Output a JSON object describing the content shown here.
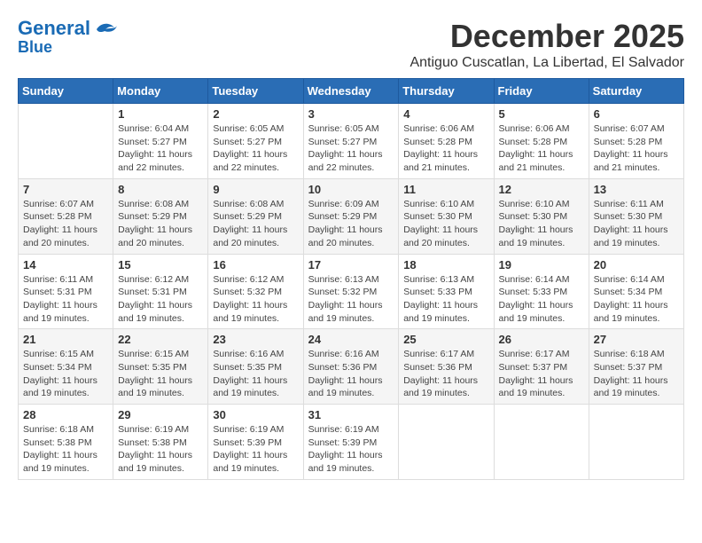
{
  "logo": {
    "line1": "General",
    "line2": "Blue"
  },
  "header": {
    "month": "December 2025",
    "location": "Antiguo Cuscatlan, La Libertad, El Salvador"
  },
  "weekdays": [
    "Sunday",
    "Monday",
    "Tuesday",
    "Wednesday",
    "Thursday",
    "Friday",
    "Saturday"
  ],
  "weeks": [
    [
      {
        "day": "",
        "info": ""
      },
      {
        "day": "1",
        "info": "Sunrise: 6:04 AM\nSunset: 5:27 PM\nDaylight: 11 hours\nand 22 minutes."
      },
      {
        "day": "2",
        "info": "Sunrise: 6:05 AM\nSunset: 5:27 PM\nDaylight: 11 hours\nand 22 minutes."
      },
      {
        "day": "3",
        "info": "Sunrise: 6:05 AM\nSunset: 5:27 PM\nDaylight: 11 hours\nand 22 minutes."
      },
      {
        "day": "4",
        "info": "Sunrise: 6:06 AM\nSunset: 5:28 PM\nDaylight: 11 hours\nand 21 minutes."
      },
      {
        "day": "5",
        "info": "Sunrise: 6:06 AM\nSunset: 5:28 PM\nDaylight: 11 hours\nand 21 minutes."
      },
      {
        "day": "6",
        "info": "Sunrise: 6:07 AM\nSunset: 5:28 PM\nDaylight: 11 hours\nand 21 minutes."
      }
    ],
    [
      {
        "day": "7",
        "info": "Sunrise: 6:07 AM\nSunset: 5:28 PM\nDaylight: 11 hours\nand 20 minutes."
      },
      {
        "day": "8",
        "info": "Sunrise: 6:08 AM\nSunset: 5:29 PM\nDaylight: 11 hours\nand 20 minutes."
      },
      {
        "day": "9",
        "info": "Sunrise: 6:08 AM\nSunset: 5:29 PM\nDaylight: 11 hours\nand 20 minutes."
      },
      {
        "day": "10",
        "info": "Sunrise: 6:09 AM\nSunset: 5:29 PM\nDaylight: 11 hours\nand 20 minutes."
      },
      {
        "day": "11",
        "info": "Sunrise: 6:10 AM\nSunset: 5:30 PM\nDaylight: 11 hours\nand 20 minutes."
      },
      {
        "day": "12",
        "info": "Sunrise: 6:10 AM\nSunset: 5:30 PM\nDaylight: 11 hours\nand 19 minutes."
      },
      {
        "day": "13",
        "info": "Sunrise: 6:11 AM\nSunset: 5:30 PM\nDaylight: 11 hours\nand 19 minutes."
      }
    ],
    [
      {
        "day": "14",
        "info": "Sunrise: 6:11 AM\nSunset: 5:31 PM\nDaylight: 11 hours\nand 19 minutes."
      },
      {
        "day": "15",
        "info": "Sunrise: 6:12 AM\nSunset: 5:31 PM\nDaylight: 11 hours\nand 19 minutes."
      },
      {
        "day": "16",
        "info": "Sunrise: 6:12 AM\nSunset: 5:32 PM\nDaylight: 11 hours\nand 19 minutes."
      },
      {
        "day": "17",
        "info": "Sunrise: 6:13 AM\nSunset: 5:32 PM\nDaylight: 11 hours\nand 19 minutes."
      },
      {
        "day": "18",
        "info": "Sunrise: 6:13 AM\nSunset: 5:33 PM\nDaylight: 11 hours\nand 19 minutes."
      },
      {
        "day": "19",
        "info": "Sunrise: 6:14 AM\nSunset: 5:33 PM\nDaylight: 11 hours\nand 19 minutes."
      },
      {
        "day": "20",
        "info": "Sunrise: 6:14 AM\nSunset: 5:34 PM\nDaylight: 11 hours\nand 19 minutes."
      }
    ],
    [
      {
        "day": "21",
        "info": "Sunrise: 6:15 AM\nSunset: 5:34 PM\nDaylight: 11 hours\nand 19 minutes."
      },
      {
        "day": "22",
        "info": "Sunrise: 6:15 AM\nSunset: 5:35 PM\nDaylight: 11 hours\nand 19 minutes."
      },
      {
        "day": "23",
        "info": "Sunrise: 6:16 AM\nSunset: 5:35 PM\nDaylight: 11 hours\nand 19 minutes."
      },
      {
        "day": "24",
        "info": "Sunrise: 6:16 AM\nSunset: 5:36 PM\nDaylight: 11 hours\nand 19 minutes."
      },
      {
        "day": "25",
        "info": "Sunrise: 6:17 AM\nSunset: 5:36 PM\nDaylight: 11 hours\nand 19 minutes."
      },
      {
        "day": "26",
        "info": "Sunrise: 6:17 AM\nSunset: 5:37 PM\nDaylight: 11 hours\nand 19 minutes."
      },
      {
        "day": "27",
        "info": "Sunrise: 6:18 AM\nSunset: 5:37 PM\nDaylight: 11 hours\nand 19 minutes."
      }
    ],
    [
      {
        "day": "28",
        "info": "Sunrise: 6:18 AM\nSunset: 5:38 PM\nDaylight: 11 hours\nand 19 minutes."
      },
      {
        "day": "29",
        "info": "Sunrise: 6:19 AM\nSunset: 5:38 PM\nDaylight: 11 hours\nand 19 minutes."
      },
      {
        "day": "30",
        "info": "Sunrise: 6:19 AM\nSunset: 5:39 PM\nDaylight: 11 hours\nand 19 minutes."
      },
      {
        "day": "31",
        "info": "Sunrise: 6:19 AM\nSunset: 5:39 PM\nDaylight: 11 hours\nand 19 minutes."
      },
      {
        "day": "",
        "info": ""
      },
      {
        "day": "",
        "info": ""
      },
      {
        "day": "",
        "info": ""
      }
    ]
  ]
}
